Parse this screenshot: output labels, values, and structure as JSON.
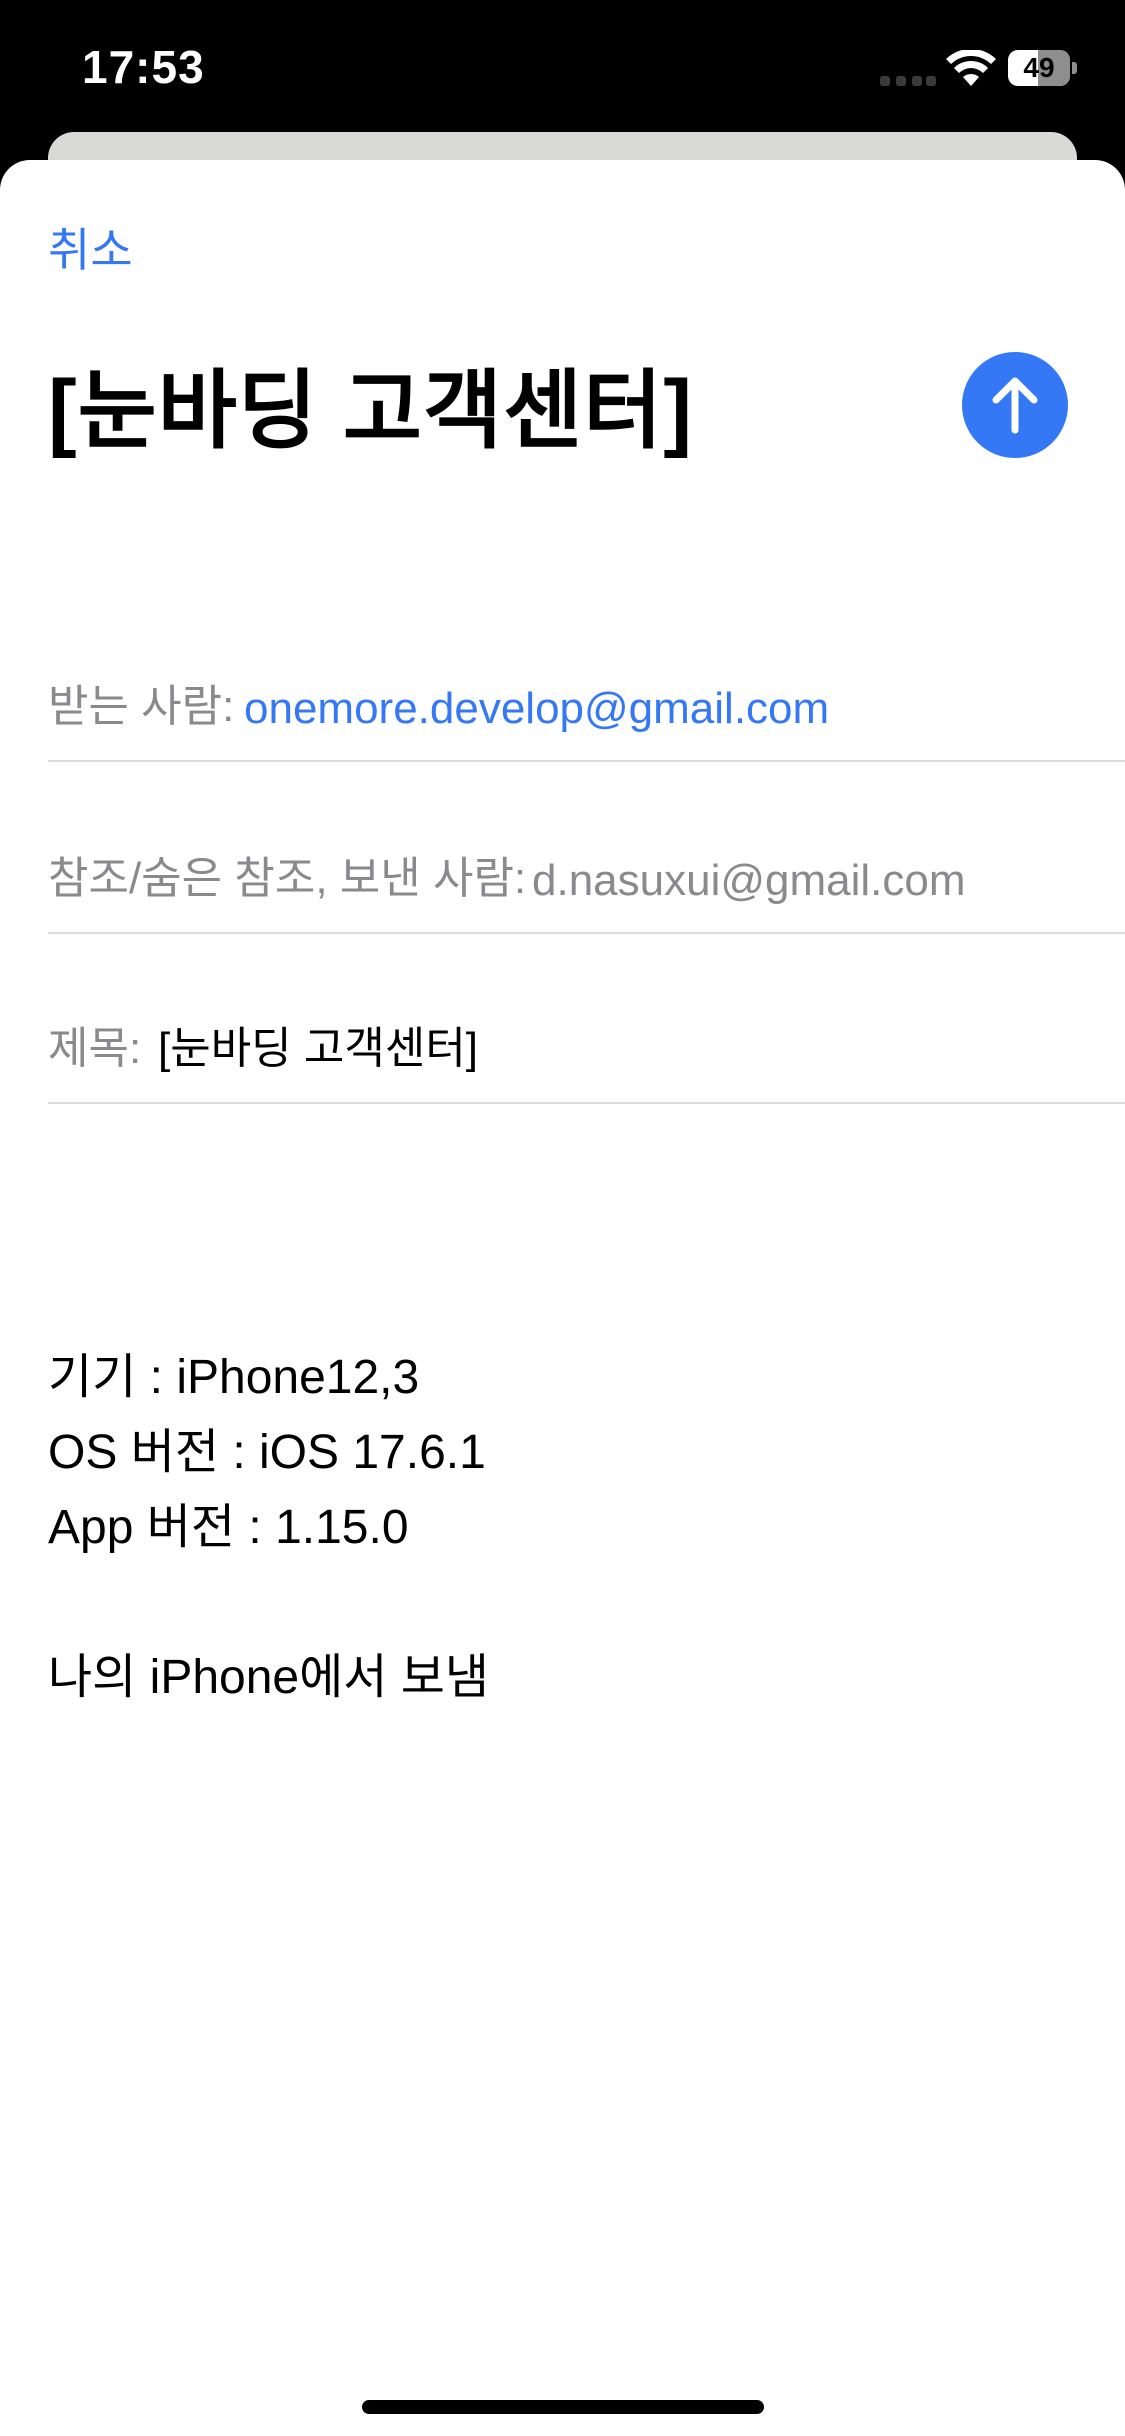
{
  "status_bar": {
    "time": "17:53",
    "battery_level": "49",
    "battery_fraction": 0.49
  },
  "compose": {
    "cancel_label": "취소",
    "title": "[눈바딩 고객센터]",
    "send_icon": "arrow-up-icon",
    "accent_color": "#3478f6",
    "to_label": "받는 사람:",
    "to_value": "onemore.develop@gmail.com",
    "cc_label": "참조/숨은 참조, 보낸 사람:",
    "cc_value": "d.nasuxui@gmail.com",
    "subject_label": "제목:",
    "subject_value": "[눈바딩 고객센터]"
  },
  "body": {
    "lines": [
      "기기 : iPhone12,3",
      "OS 버전 : iOS 17.6.1",
      "App 버전 : 1.15.0"
    ],
    "signature": "나의 iPhone에서 보냄"
  }
}
